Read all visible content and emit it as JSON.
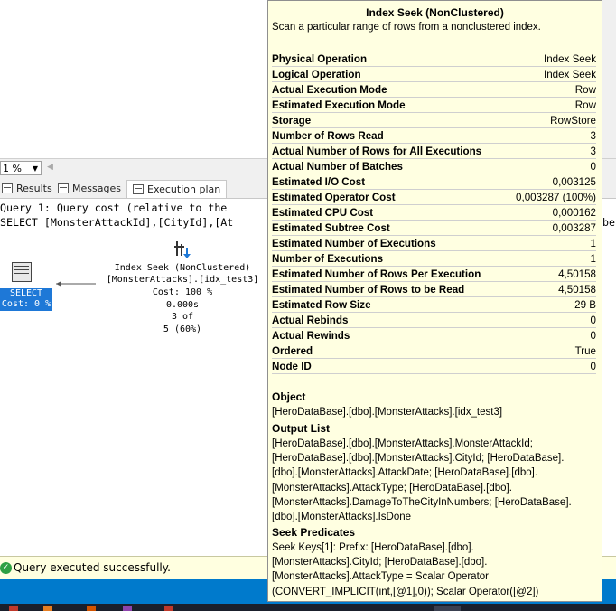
{
  "zoom": {
    "value": "1 %"
  },
  "tabs": [
    {
      "label": "Results"
    },
    {
      "label": "Messages"
    },
    {
      "label": "Execution plan"
    }
  ],
  "plan": {
    "query_line": "Query 1: Query cost (relative to the",
    "select_line": "SELECT [MonsterAttackId],[CityId],[At",
    "select_line_end": "be:",
    "select_node": {
      "label": "SELECT",
      "cost": "Cost: 0 %"
    },
    "seek_node": {
      "title": "Index Seek (NonClustered)",
      "object": "[MonsterAttacks].[idx_test3]",
      "cost": "Cost: 100 %",
      "time": "0.000s",
      "rows": "3 of",
      "estimate": "5 (60%)"
    }
  },
  "tooltip": {
    "title": "Index Seek (NonClustered)",
    "description": "Scan a particular range of rows from a nonclustered index.",
    "properties": [
      {
        "name": "Physical Operation",
        "value": "Index Seek"
      },
      {
        "name": "Logical Operation",
        "value": "Index Seek"
      },
      {
        "name": "Actual Execution Mode",
        "value": "Row"
      },
      {
        "name": "Estimated Execution Mode",
        "value": "Row"
      },
      {
        "name": "Storage",
        "value": "RowStore"
      },
      {
        "name": "Number of Rows Read",
        "value": "3"
      },
      {
        "name": "Actual Number of Rows for All Executions",
        "value": "3"
      },
      {
        "name": "Actual Number of Batches",
        "value": "0"
      },
      {
        "name": "Estimated I/O Cost",
        "value": "0,003125"
      },
      {
        "name": "Estimated Operator Cost",
        "value": "0,003287 (100%)"
      },
      {
        "name": "Estimated CPU Cost",
        "value": "0,000162"
      },
      {
        "name": "Estimated Subtree Cost",
        "value": "0,003287"
      },
      {
        "name": "Estimated Number of Executions",
        "value": "1"
      },
      {
        "name": "Number of Executions",
        "value": "1"
      },
      {
        "name": "Estimated Number of Rows Per Execution",
        "value": "4,50158"
      },
      {
        "name": "Estimated Number of Rows to be Read",
        "value": "4,50158"
      },
      {
        "name": "Estimated Row Size",
        "value": "29 B"
      },
      {
        "name": "Actual Rebinds",
        "value": "0"
      },
      {
        "name": "Actual Rewinds",
        "value": "0"
      },
      {
        "name": "Ordered",
        "value": "True"
      },
      {
        "name": "Node ID",
        "value": "0"
      }
    ],
    "object_heading": "Object",
    "object_text": "[HeroDataBase].[dbo].[MonsterAttacks].[idx_test3]",
    "output_heading": "Output List",
    "output_lines": [
      "[HeroDataBase].[dbo].[MonsterAttacks].MonsterAttackId;",
      "[HeroDataBase].[dbo].[MonsterAttacks].CityId; [HeroDataBase].",
      "[dbo].[MonsterAttacks].AttackDate; [HeroDataBase].[dbo].",
      "[MonsterAttacks].AttackType; [HeroDataBase].[dbo].",
      "[MonsterAttacks].DamageToTheCityInNumbers; [HeroDataBase].",
      "[dbo].[MonsterAttacks].IsDone"
    ],
    "seek_heading": "Seek Predicates",
    "seek_lines": [
      "Seek Keys[1]: Prefix: [HeroDataBase].[dbo].",
      "[MonsterAttacks].CityId; [HeroDataBase].[dbo].",
      "[MonsterAttacks].AttackType = Scalar Operator",
      "(CONVERT_IMPLICIT(int,[@1],0)); Scalar Operator([@2])"
    ]
  },
  "status": {
    "text": "Query executed successfully."
  },
  "colors": {
    "accent": "#007acc",
    "tooltip_bg": "#ffffe1",
    "select_highlight": "#1e78d7",
    "status_bg": "#ffffe0"
  }
}
